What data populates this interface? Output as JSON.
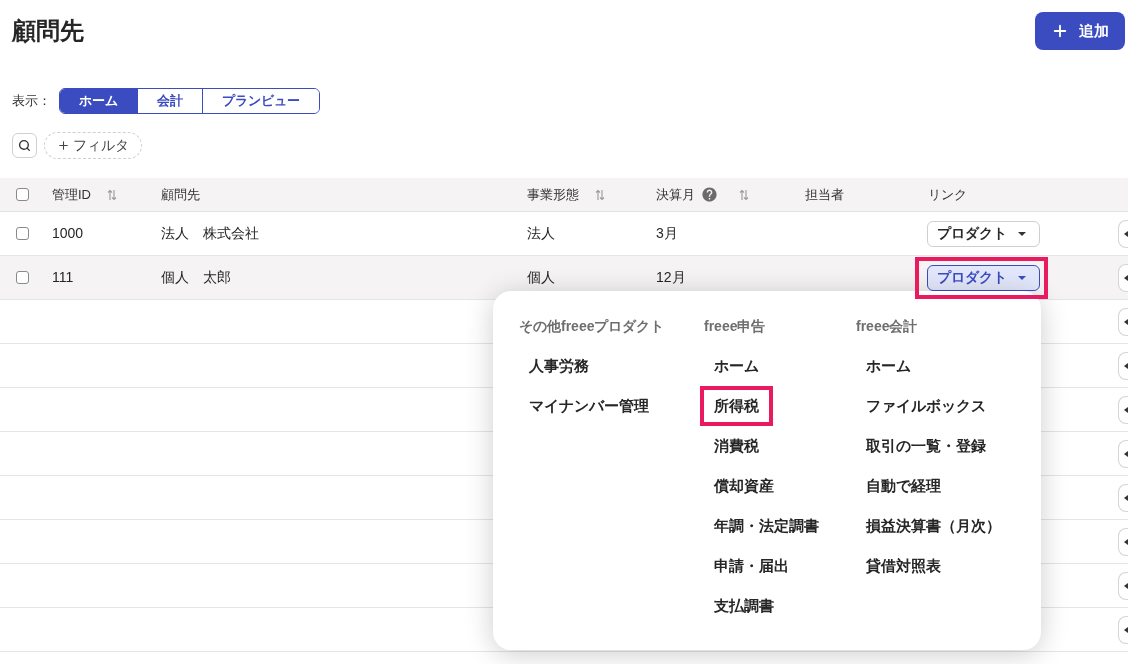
{
  "page": {
    "title": "顧問先",
    "add_button": "追加"
  },
  "view_switch": {
    "label": "表示：",
    "options": [
      {
        "label": "ホーム",
        "selected": true
      },
      {
        "label": "会計",
        "selected": false
      },
      {
        "label": "プランビュー",
        "selected": false
      }
    ]
  },
  "filter_button": "フィルタ",
  "table": {
    "select_all_checked": false,
    "columns": [
      {
        "label": "管理ID",
        "sortable": true,
        "help": false
      },
      {
        "label": "顧問先",
        "sortable": false,
        "help": false
      },
      {
        "label": "事業形態",
        "sortable": true,
        "help": false
      },
      {
        "label": "決算月",
        "sortable": true,
        "help": true
      },
      {
        "label": "担当者",
        "sortable": false,
        "help": false
      },
      {
        "label": "リンク",
        "sortable": false,
        "help": false
      }
    ],
    "rows": [
      {
        "kind": "data",
        "checked": false,
        "highlighted": false,
        "id": "1000",
        "client": "法人　株式会社",
        "business_type": "法人",
        "closing_month": "3月",
        "link": {
          "label": "プロダクト",
          "open": false,
          "annotated": false
        }
      },
      {
        "kind": "data",
        "checked": false,
        "highlighted": true,
        "id": "111",
        "client": "個人　太郎",
        "business_type": "個人",
        "closing_month": "12月",
        "link": {
          "label": "プロダクト",
          "open": true,
          "annotated": true
        }
      },
      {
        "kind": "empty",
        "highlighted": false
      },
      {
        "kind": "empty",
        "highlighted": false
      },
      {
        "kind": "empty",
        "highlighted": false
      },
      {
        "kind": "empty",
        "highlighted": false
      },
      {
        "kind": "empty",
        "highlighted": false
      },
      {
        "kind": "empty",
        "highlighted": false
      },
      {
        "kind": "empty",
        "highlighted": false
      },
      {
        "kind": "empty",
        "highlighted": false
      }
    ]
  },
  "product_menu": {
    "groups": [
      {
        "heading": "その他freeeプロダクト",
        "items": [
          {
            "label": "人事労務",
            "annotated": false
          },
          {
            "label": "マイナンバー管理",
            "annotated": false
          }
        ]
      },
      {
        "heading": "freee申告",
        "items": [
          {
            "label": "ホーム",
            "annotated": false
          },
          {
            "label": "所得税",
            "annotated": true
          },
          {
            "label": "消費税",
            "annotated": false
          },
          {
            "label": "償却資産",
            "annotated": false
          },
          {
            "label": "年調・法定調書",
            "annotated": false
          },
          {
            "label": "申請・届出",
            "annotated": false
          },
          {
            "label": "支払調書",
            "annotated": false
          }
        ]
      },
      {
        "heading": "freee会計",
        "items": [
          {
            "label": "ホーム",
            "annotated": false
          },
          {
            "label": "ファイルボックス",
            "annotated": false
          },
          {
            "label": "取引の一覧・登録",
            "annotated": false
          },
          {
            "label": "自動で経理",
            "annotated": false
          },
          {
            "label": "損益決算書（月次）",
            "annotated": false
          },
          {
            "label": "貸借対照表",
            "annotated": false
          }
        ]
      }
    ]
  }
}
